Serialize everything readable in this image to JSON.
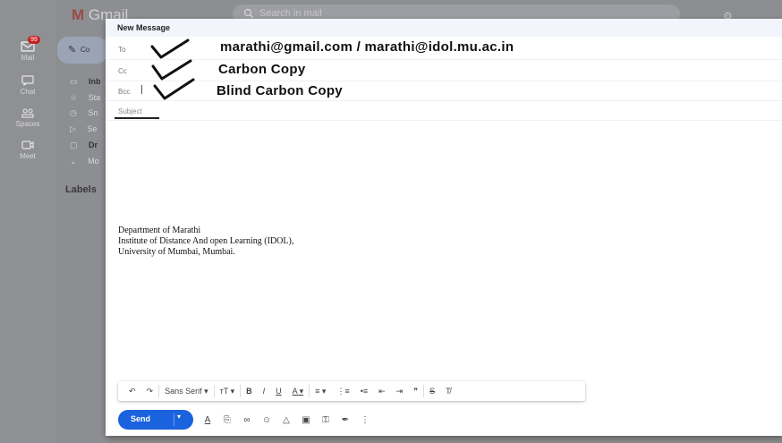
{
  "app": {
    "logo": "Gmail",
    "search_placeholder": "Search in mail"
  },
  "rail": [
    {
      "label": "Mail",
      "icon": "mail-icon",
      "badge": "99"
    },
    {
      "label": "Chat",
      "icon": "chat-icon"
    },
    {
      "label": "Spaces",
      "icon": "spaces-icon"
    },
    {
      "label": "Meet",
      "icon": "meet-icon"
    }
  ],
  "sidenav": {
    "compose_label": "Co",
    "items": [
      {
        "label": "Inb",
        "icon": "inbox-icon"
      },
      {
        "label": "Sta",
        "icon": "star-icon"
      },
      {
        "label": "Sn",
        "icon": "clock-icon"
      },
      {
        "label": "Se",
        "icon": "send-icon"
      },
      {
        "label": "Dr",
        "icon": "draft-icon"
      },
      {
        "label": "Mo",
        "icon": "chevron-down-icon"
      }
    ],
    "labels_heading": "Labels"
  },
  "compose": {
    "title": "New Message",
    "to_label": "To",
    "cc_label": "Cc",
    "bcc_label": "Bcc",
    "subject_placeholder": "Subject",
    "annotations": {
      "to": "marathi@gmail.com / marathi@idol.mu.ac.in",
      "cc": "Carbon Copy",
      "bcc": "Blind Carbon Copy"
    },
    "signature": [
      "Department of Marathi",
      "Institute of Distance And open Learning (IDOL),",
      "University of Mumbai, Mumbai."
    ],
    "toolbar": {
      "undo": "↶",
      "redo": "↷",
      "font": "Sans Serif ▾",
      "size": "тT ▾",
      "bold": "B",
      "italic": "I",
      "underline": "U",
      "text_color": "A ▾",
      "align": "≡ ▾",
      "numbered_list": "⋮≡",
      "bulleted_list": "•≡",
      "indent_less": "⇤",
      "indent_more": "⇥",
      "quote": "❞",
      "strikethrough": "S",
      "clear_format": "T̸"
    },
    "send_label": "Send",
    "colors": {
      "send": "#1b63de",
      "header": "#f2f6fc"
    }
  }
}
